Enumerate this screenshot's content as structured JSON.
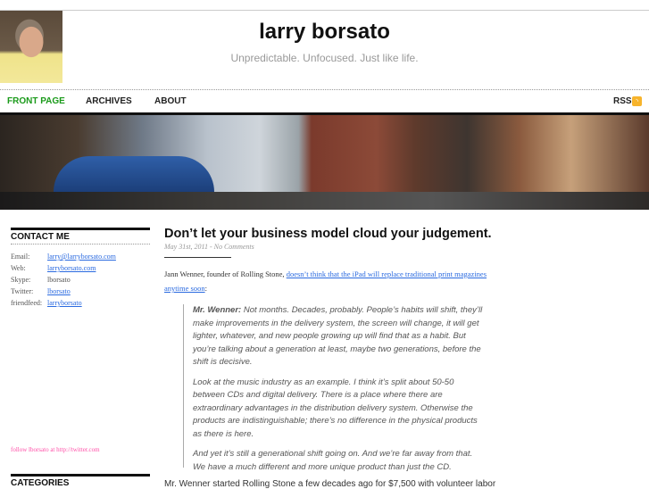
{
  "header": {
    "title": "larry borsato",
    "tagline": "Unpredictable. Unfocused. Just like life."
  },
  "nav": {
    "items": [
      {
        "label": "FRONT PAGE",
        "color": "#1a9a1a"
      },
      {
        "label": "ARCHIVES"
      },
      {
        "label": "ABOUT"
      }
    ],
    "rss_label": "RSS"
  },
  "sidebar": {
    "contact_title": "CONTACT ME",
    "contacts": [
      {
        "label": "Email:",
        "value": "larry@larryborsato.com",
        "link": true
      },
      {
        "label": "Web:",
        "value": "larryborsato.com",
        "link": true
      },
      {
        "label": "Skype:",
        "value": "lborsato",
        "link": false
      },
      {
        "label": "Twitter:",
        "value": "lborsato",
        "link": true
      },
      {
        "label": "friendfeed:",
        "value": "larryborsato",
        "link": true
      }
    ],
    "follow": "follow lborsato at http://twitter.com",
    "categories_title": "CATEGORIES"
  },
  "post": {
    "title": "Don’t let your business model cloud your judgement.",
    "meta": "May 31st, 2011 - No Comments",
    "intro": "Jann Wenner, founder of Rolling Stone, ",
    "intro_link": "doesn’t think that the iPad will replace traditional print magazines anytime soon",
    "intro_end": ":",
    "quote_speaker": "Mr. Wenner:",
    "quote1": " Not months. Decades, probably. People’s habits will shift, they’ll make improvements in the delivery system, the screen will change, it will get lighter, whatever, and new people growing up will find that as a habit. But you’re talking about a generation at least, maybe two generations, before the shift is decisive.",
    "quote2": "Look at the music industry as an example. I think it’s split about 50-50 between CDs and digital delivery. There is a place where there are extraordinary advantages in the distribution delivery system. Otherwise the products are indistinguishable; there’s no difference in the physical products as there is here.",
    "quote3": "And yet it’s still a generational shift going on. And we’re far away from that. We have a much different and more unique product than just the CD.",
    "para2": "Mr. Wenner started Rolling Stone a few decades ago for $7,500 with volunteer labor"
  }
}
